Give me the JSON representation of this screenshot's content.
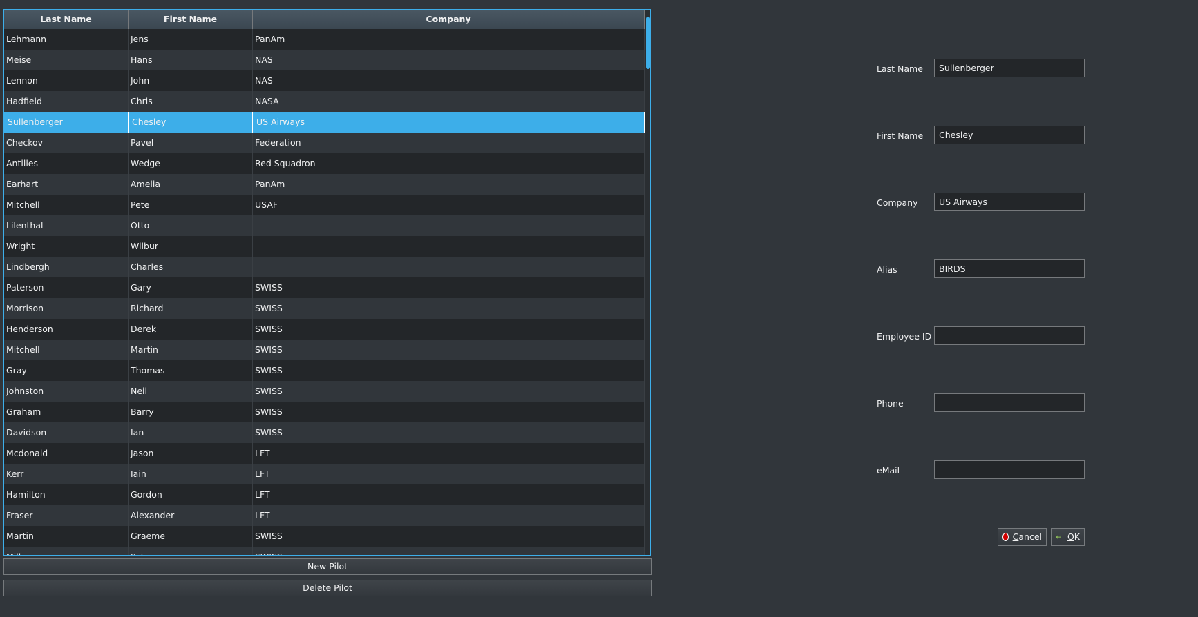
{
  "table": {
    "columns": [
      "Last Name",
      "First Name",
      "Company"
    ],
    "rows": [
      [
        "Lehmann",
        "Jens",
        "PanAm"
      ],
      [
        "Meise",
        "Hans",
        "NAS"
      ],
      [
        "Lennon",
        "John",
        "NAS"
      ],
      [
        "Hadfield",
        "Chris",
        "NASA"
      ],
      [
        "Sullenberger",
        "Chesley",
        "US Airways"
      ],
      [
        "Checkov",
        "Pavel",
        "Federation"
      ],
      [
        "Antilles",
        "Wedge",
        "Red Squadron"
      ],
      [
        "Earhart",
        "Amelia",
        "PanAm"
      ],
      [
        "Mitchell",
        "Pete",
        "USAF"
      ],
      [
        "Lilenthal",
        "Otto",
        ""
      ],
      [
        "Wright",
        "Wilbur",
        ""
      ],
      [
        "Lindbergh",
        "Charles",
        ""
      ],
      [
        "Paterson",
        "Gary",
        "SWISS"
      ],
      [
        "Morrison",
        "Richard",
        "SWISS"
      ],
      [
        "Henderson",
        "Derek",
        "SWISS"
      ],
      [
        "Mitchell",
        "Martin",
        "SWISS"
      ],
      [
        "Gray",
        "Thomas",
        "SWISS"
      ],
      [
        "Johnston",
        "Neil",
        "SWISS"
      ],
      [
        "Graham",
        "Barry",
        "SWISS"
      ],
      [
        "Davidson",
        "Ian",
        "SWISS"
      ],
      [
        "Mcdonald",
        "Jason",
        "LFT"
      ],
      [
        "Kerr",
        "Iain",
        "LFT"
      ],
      [
        "Hamilton",
        "Gordon",
        "LFT"
      ],
      [
        "Fraser",
        "Alexander",
        "LFT"
      ],
      [
        "Martin",
        "Graeme",
        "SWISS"
      ],
      [
        "Miller",
        "Peter",
        "SWISS"
      ]
    ],
    "selected_index": 4
  },
  "buttons": {
    "new_pilot": "New Pilot",
    "delete_pilot": "Delete Pilot",
    "cancel_rest": "ancel",
    "cancel_mnemonic": "C",
    "ok_mnemonic": "O",
    "ok_rest": "K"
  },
  "form": {
    "last_name_label": "Last Name",
    "last_name_value": "Sullenberger",
    "first_name_label": "First Name",
    "first_name_value": "Chesley",
    "company_label": "Company",
    "company_value": "US Airways",
    "alias_label": "Alias",
    "alias_value": "BIRDS",
    "employee_id_label": "Employee ID",
    "employee_id_value": "",
    "phone_label": "Phone",
    "phone_value": "",
    "email_label": "eMail",
    "email_value": ""
  },
  "colors": {
    "background": "#31363b",
    "accent": "#3daee9"
  },
  "icons": {
    "cancel": "cancel-icon",
    "ok": "ok-icon"
  }
}
